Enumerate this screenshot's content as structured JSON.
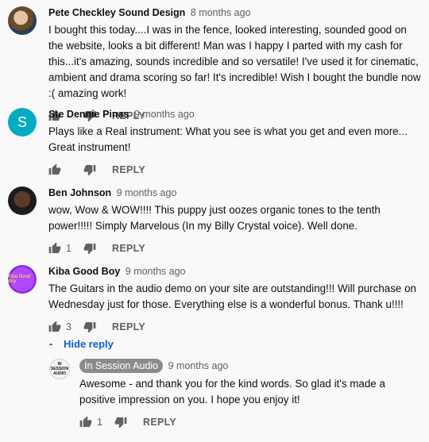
{
  "comments": [
    {
      "author": "Pete Checkley Sound Design",
      "time": "8 months ago",
      "text": "I bought this today....I was in the fence, looked interesting, sounded good on the website, looks a bit different! Man was I happy I parted with my cash for this...it's amazing, sounds incredible and so versatile! I've used it for cinematic, ambient and drama scoring so far! It's incredible! Wish I bought the bundle now :( amazing work!",
      "likes": "",
      "reply_label": "REPLY"
    },
    {
      "author": "Ste Dennie Pinas",
      "time": "9 months ago",
      "avatar_letter": "S",
      "text": "Plays like a Real instrument:  What you see is what you get and even more... Great instrument!",
      "likes": "",
      "reply_label": "REPLY"
    },
    {
      "author": "Ben Johnson",
      "time": "9 months ago",
      "text": "wow, Wow & WOW!!!! This puppy just oozes organic tones to the tenth power!!!!! Simply Marvelous (In my Billy Crystal voice). Well done.",
      "likes": "1",
      "reply_label": "REPLY"
    },
    {
      "author": "Kiba Good Boy",
      "time": "9 months ago",
      "avatar_text": "Kiba Good Boy",
      "text": "The Guitars in the audio demo on your site are outstanding!!! Will purchase on Wednesday just for those. Everything else is a wonderful bonus. Thank u!!!!",
      "likes": "3",
      "reply_label": "REPLY"
    }
  ],
  "hide_reply_label": "Hide reply",
  "reply": {
    "author": "In Session Audio",
    "time": "9 months ago",
    "avatar_text": "IN SESSION AUDIO",
    "text": "Awesome - and thank you for the kind words.  So glad it's made a positive impression on you.  I hope you enjoy it!",
    "likes": "1",
    "reply_label": "REPLY"
  },
  "icons": {
    "like": "thumbs-up-icon",
    "dislike": "thumbs-down-icon",
    "collapse": "chevron-up-icon"
  },
  "colors": {
    "link_blue": "#065fd4",
    "secondary_text": "#606060",
    "badge_gray": "#8b8b8b",
    "ste_avatar": "#00acc1"
  }
}
